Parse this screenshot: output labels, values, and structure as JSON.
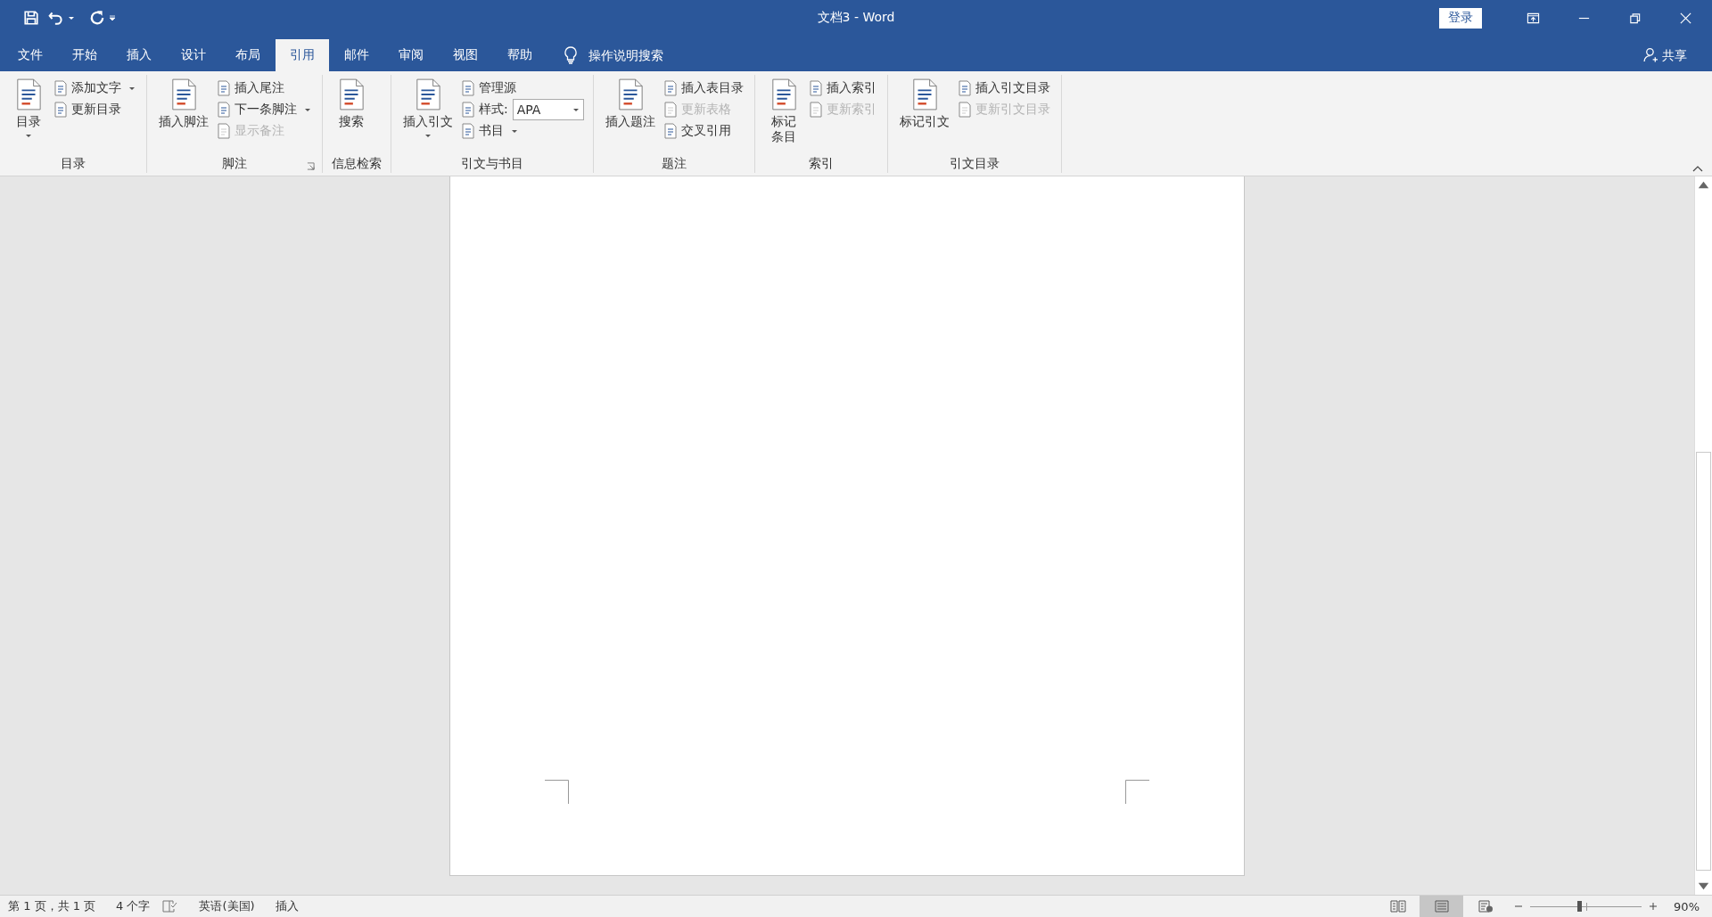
{
  "window": {
    "title": "文档3  -  Word",
    "login": "登录"
  },
  "tabs": [
    {
      "label": "文件",
      "selected": false
    },
    {
      "label": "开始",
      "selected": false
    },
    {
      "label": "插入",
      "selected": false
    },
    {
      "label": "设计",
      "selected": false
    },
    {
      "label": "布局",
      "selected": false
    },
    {
      "label": "引用",
      "selected": true
    },
    {
      "label": "邮件",
      "selected": false
    },
    {
      "label": "审阅",
      "selected": false
    },
    {
      "label": "视图",
      "selected": false
    },
    {
      "label": "帮助",
      "selected": false
    }
  ],
  "tell_me": "操作说明搜索",
  "share": "共享",
  "ribbon_groups": [
    {
      "label": "目录",
      "launcher": false,
      "columns": [
        {
          "kind": "large",
          "label": "目录",
          "dropdown": true,
          "wrap": false
        },
        {
          "kind": "stack",
          "items": [
            {
              "label": "添加文字",
              "disabled": false,
              "dropdown": true
            },
            {
              "label": "更新目录",
              "disabled": false,
              "dropdown": false
            }
          ]
        }
      ]
    },
    {
      "label": "脚注",
      "launcher": true,
      "columns": [
        {
          "kind": "large",
          "label": "插入脚注",
          "dropdown": false,
          "wrap": false
        },
        {
          "kind": "stack",
          "items": [
            {
              "label": "插入尾注",
              "disabled": false,
              "dropdown": false
            },
            {
              "label": "下一条脚注",
              "disabled": false,
              "dropdown": true
            },
            {
              "label": "显示备注",
              "disabled": true,
              "dropdown": false
            }
          ]
        }
      ]
    },
    {
      "label": "信息检索",
      "launcher": false,
      "columns": [
        {
          "kind": "large",
          "label": "搜索",
          "dropdown": false,
          "wrap": true
        }
      ]
    },
    {
      "label": "引文与书目",
      "launcher": false,
      "columns": [
        {
          "kind": "large",
          "label": "插入引文",
          "dropdown": true,
          "wrap": false
        },
        {
          "kind": "stack",
          "items": [
            {
              "label": "管理源",
              "disabled": false,
              "dropdown": false
            },
            {
              "label": "样式:",
              "disabled": false,
              "dropdown": false,
              "combo": "APA"
            },
            {
              "label": "书目",
              "disabled": false,
              "dropdown": true
            }
          ]
        }
      ]
    },
    {
      "label": "题注",
      "launcher": false,
      "columns": [
        {
          "kind": "large",
          "label": "插入题注",
          "dropdown": false,
          "wrap": false
        },
        {
          "kind": "stack",
          "items": [
            {
              "label": "插入表目录",
              "disabled": false,
              "dropdown": false
            },
            {
              "label": "更新表格",
              "disabled": true,
              "dropdown": false
            },
            {
              "label": "交叉引用",
              "disabled": false,
              "dropdown": false
            }
          ]
        }
      ]
    },
    {
      "label": "索引",
      "launcher": false,
      "columns": [
        {
          "kind": "large",
          "label": "标记条目",
          "dropdown": false,
          "wrap": true
        },
        {
          "kind": "stack",
          "items": [
            {
              "label": "插入索引",
              "disabled": false,
              "dropdown": false
            },
            {
              "label": "更新索引",
              "disabled": true,
              "dropdown": false
            }
          ]
        }
      ]
    },
    {
      "label": "引文目录",
      "launcher": false,
      "columns": [
        {
          "kind": "large",
          "label": "标记引文",
          "dropdown": false,
          "wrap": false
        },
        {
          "kind": "stack",
          "items": [
            {
              "label": "插入引文目录",
              "disabled": false,
              "dropdown": false
            },
            {
              "label": "更新引文目录",
              "disabled": true,
              "dropdown": false
            }
          ]
        }
      ]
    }
  ],
  "status_bar": {
    "left": [
      "第 1 页，共 1 页",
      "4 个字"
    ],
    "language": "英语(美国)",
    "mode": "插入",
    "views": [
      {
        "selected": false
      },
      {
        "selected": true
      },
      {
        "selected": false
      }
    ],
    "zoom": {
      "level": 0.44,
      "reading": "90%"
    }
  }
}
